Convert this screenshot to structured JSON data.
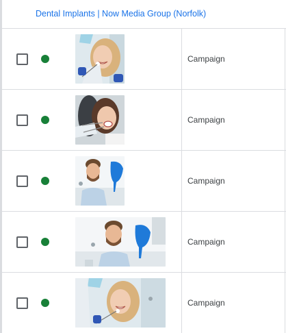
{
  "header": {
    "link_text": "Dental Implants | Now Media Group (Norfolk)"
  },
  "status_color": "#188038",
  "rows": [
    {
      "image_icon": "smiling-woman-dental-photo",
      "type": "Campaign",
      "status": "enabled"
    },
    {
      "image_icon": "woman-dental-exam-photo",
      "type": "Campaign",
      "status": "enabled"
    },
    {
      "image_icon": "bearded-man-dental-chair-photo",
      "type": "Campaign",
      "status": "enabled"
    },
    {
      "image_icon": "bearded-man-dental-chair-photo",
      "type": "Campaign",
      "status": "enabled"
    },
    {
      "image_icon": "smiling-woman-dental-photo",
      "type": "Campaign",
      "status": "enabled"
    }
  ]
}
